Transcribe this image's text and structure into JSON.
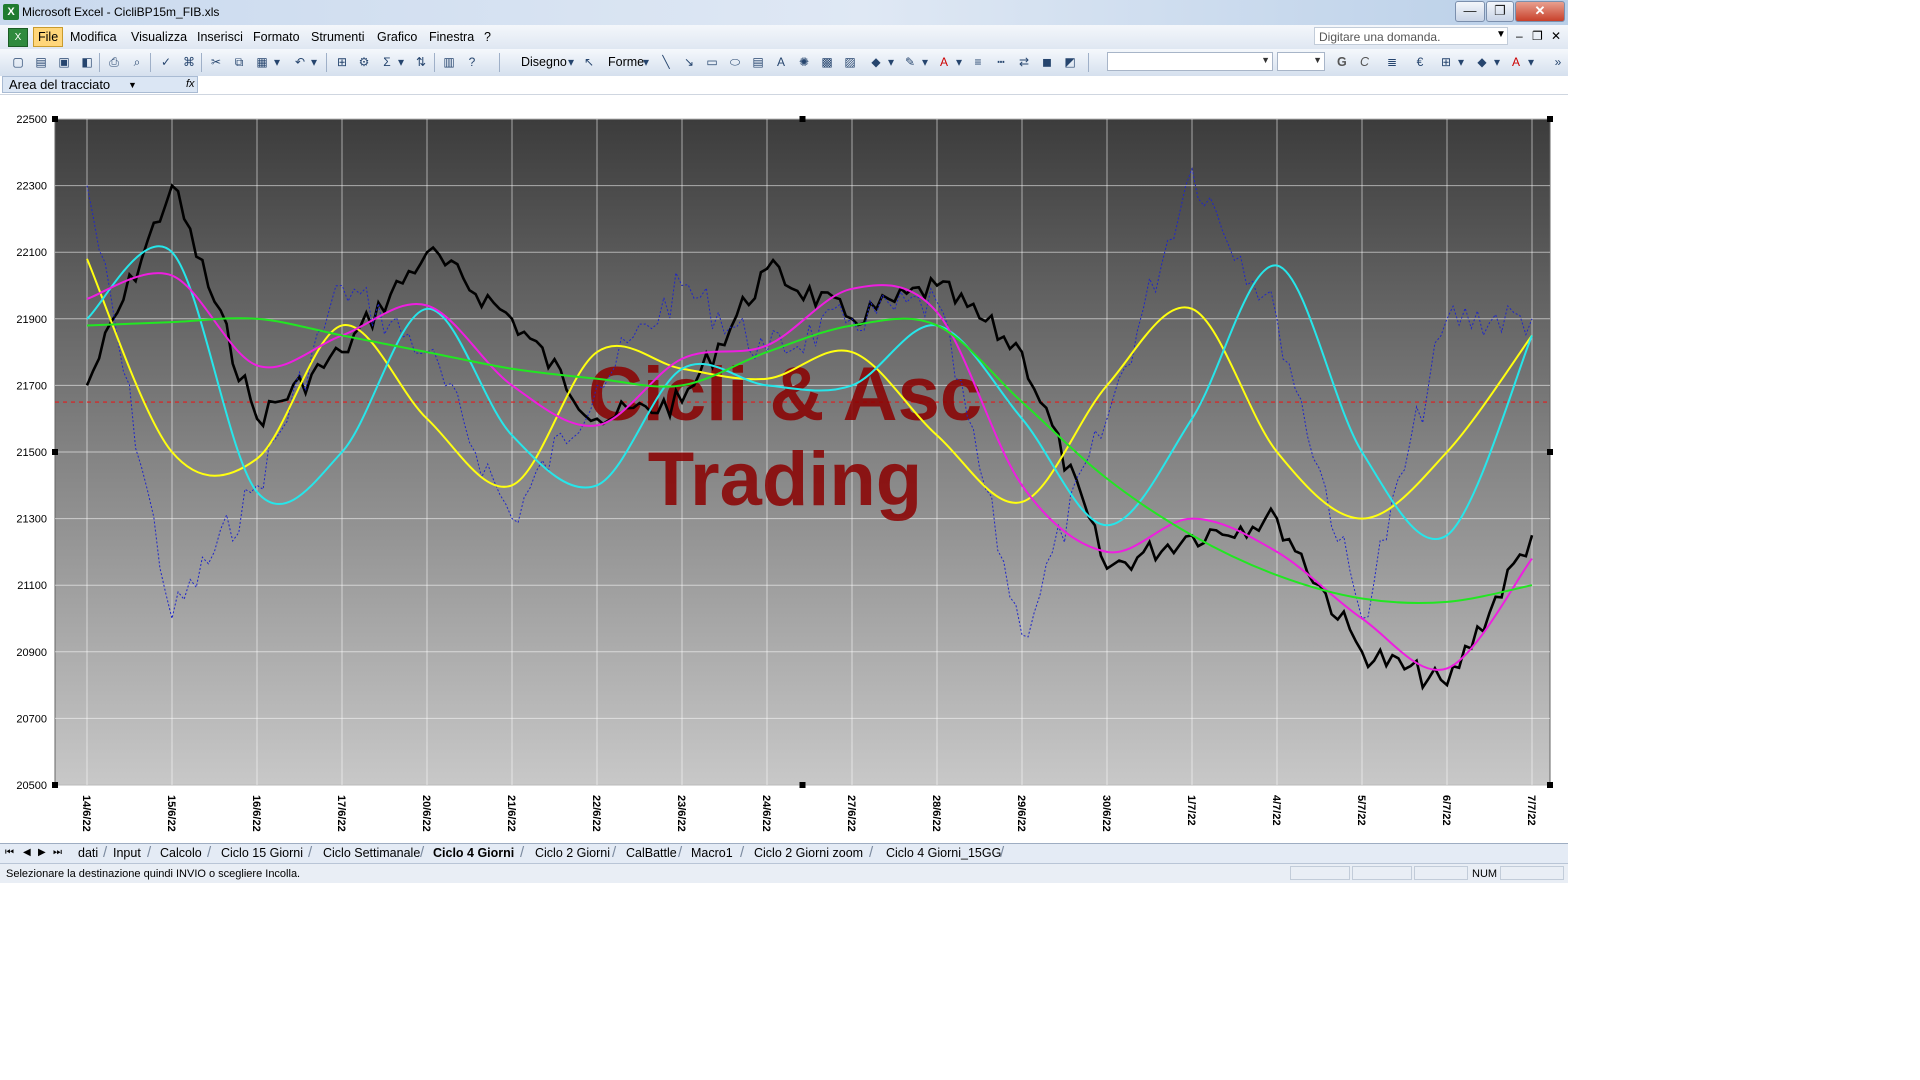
{
  "window": {
    "title": "Microsoft Excel - CicliBP15m_FIB.xls",
    "app_icon": "excel-icon",
    "buttons": {
      "minimize": "—",
      "maximize": "❐",
      "close": "✕"
    }
  },
  "menu": {
    "items": [
      "File",
      "Modifica",
      "Visualizza",
      "Inserisci",
      "Formato",
      "Strumenti",
      "Grafico",
      "Finestra",
      "?"
    ],
    "active": "File",
    "help_placeholder": "Digitare una domanda."
  },
  "toolbar": {
    "disegno_label": "Disegno",
    "forme_label": "Forme",
    "bold_label": "G",
    "italic_label": "C"
  },
  "namebox": {
    "value": "Area del tracciato",
    "fx": "fx"
  },
  "watermark": {
    "line1": "Cicli & Asc",
    "line2": "Trading"
  },
  "colors": {
    "price": "#000000",
    "dotted": "#1f26c8",
    "yellow": "#ffff10",
    "cyan": "#26e6ea",
    "magenta": "#ee1ee0",
    "green": "#22e622",
    "reference": "#e31b1b",
    "watermark": "#8b0000"
  },
  "chart_data": {
    "type": "line",
    "x": [
      "14/6/22",
      "15/6/22",
      "16/6/22",
      "17/6/22",
      "20/6/22",
      "21/6/22",
      "22/6/22",
      "23/6/22",
      "24/6/22",
      "27/6/22",
      "28/6/22",
      "29/6/22",
      "30/6/22",
      "1/7/22",
      "4/7/22",
      "5/7/22",
      "6/7/22",
      "7/7/22"
    ],
    "ylim": [
      20500,
      22500
    ],
    "yticks": [
      22500,
      22300,
      22100,
      21900,
      21700,
      21500,
      21300,
      21100,
      20900,
      20700,
      20500
    ],
    "reference_line": 21650,
    "grid": true,
    "legend": "none",
    "series": [
      {
        "key": "price",
        "style": "solid-thick",
        "values": [
          21700,
          22300,
          21600,
          21800,
          22100,
          21900,
          21600,
          21650,
          22050,
          21900,
          22000,
          21800,
          21150,
          21250,
          21300,
          20900,
          20800,
          21250
        ]
      },
      {
        "key": "dotted",
        "style": "dotted",
        "values": [
          22300,
          21000,
          21400,
          22000,
          21800,
          21300,
          21700,
          22000,
          21800,
          21900,
          21950,
          20950,
          21600,
          22350,
          21900,
          21000,
          21900,
          21900
        ]
      },
      {
        "key": "yellow",
        "style": "solid",
        "values": [
          22080,
          21500,
          21480,
          21880,
          21600,
          21400,
          21800,
          21750,
          21720,
          21800,
          21550,
          21350,
          21700,
          21930,
          21500,
          21300,
          21500,
          21850
        ]
      },
      {
        "key": "cyan",
        "style": "solid",
        "values": [
          21900,
          22100,
          21380,
          21500,
          21930,
          21550,
          21400,
          21750,
          21700,
          21700,
          21880,
          21600,
          21280,
          21600,
          22060,
          21500,
          21250,
          21850
        ]
      },
      {
        "key": "magenta",
        "style": "solid",
        "values": [
          21960,
          22030,
          21760,
          21850,
          21940,
          21700,
          21580,
          21780,
          21820,
          21990,
          21920,
          21400,
          21200,
          21300,
          21200,
          21000,
          20850,
          21180
        ]
      },
      {
        "key": "green",
        "style": "solid",
        "values": [
          21880,
          21890,
          21900,
          21850,
          21800,
          21750,
          21720,
          21700,
          21800,
          21880,
          21880,
          21650,
          21420,
          21250,
          21130,
          21060,
          21050,
          21100
        ]
      }
    ]
  },
  "sheets": {
    "tabs": [
      "dati",
      "Input",
      "Calcolo",
      "Ciclo 15 Giorni",
      "Ciclo Settimanale",
      "Ciclo 4 Giorni",
      "Ciclo 2 Giorni",
      "CalBattle",
      "Macro1",
      "Ciclo 2 Giorni zoom",
      "Ciclo 4 Giorni_15GG"
    ],
    "active": "Ciclo 4 Giorni"
  },
  "status": {
    "message": "Selezionare la destinazione quindi INVIO o scegliere Incolla.",
    "num": "NUM"
  }
}
